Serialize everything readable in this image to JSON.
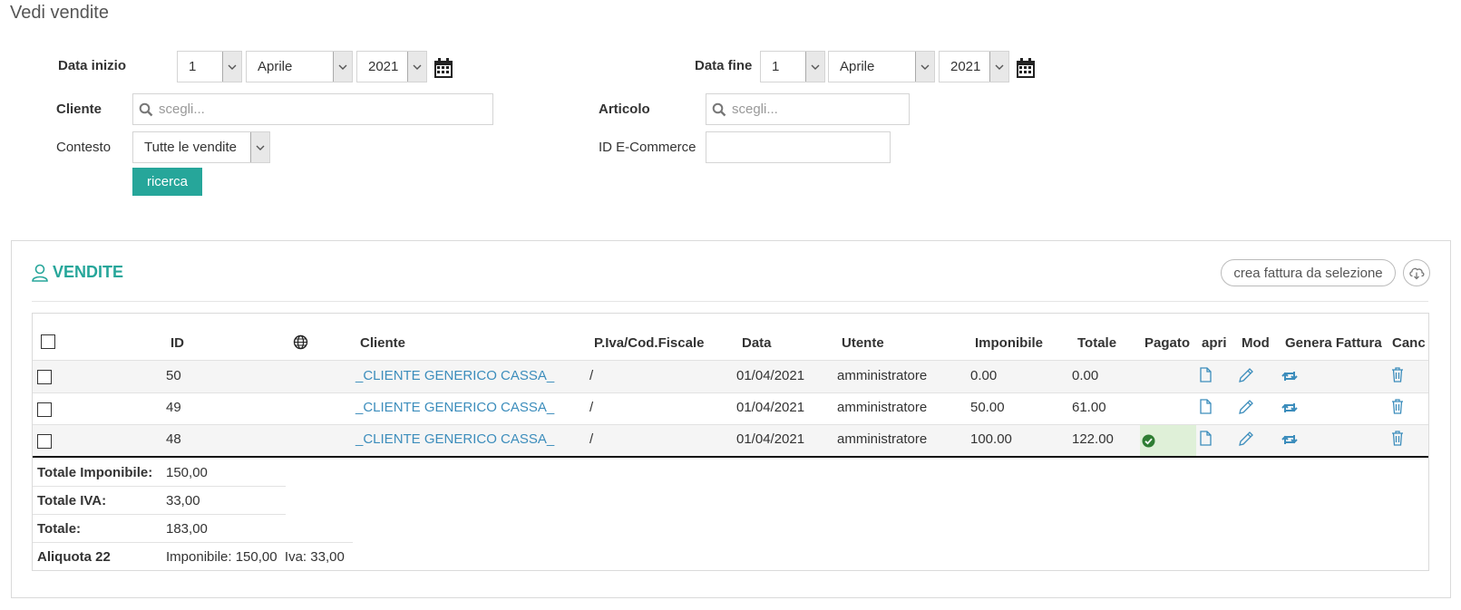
{
  "page": {
    "title": "Vedi vendite"
  },
  "filters": {
    "start_label": "Data inizio",
    "start_day": "1",
    "start_month": "Aprile",
    "start_year": "2021",
    "end_label": "Data fine",
    "end_day": "1",
    "end_month": "Aprile",
    "end_year": "2021",
    "cliente_label": "Cliente",
    "cliente_placeholder": "scegli...",
    "articolo_label": "Articolo",
    "articolo_placeholder": "scegli...",
    "contesto_label": "Contesto",
    "contesto_value": "Tutte le vendite",
    "ecommerce_label": "ID E-Commerce",
    "ecommerce_value": "",
    "search_button": "ricerca"
  },
  "panel": {
    "title": "VENDITE",
    "create_invoice_button": "crea fattura da selezione",
    "icons": {
      "title": "user-icon",
      "download": "cloud-download-icon"
    }
  },
  "table": {
    "headers": {
      "id": "ID",
      "web": "globe-icon",
      "cliente": "Cliente",
      "piva": "P.Iva/Cod.Fiscale",
      "data": "Data",
      "utente": "Utente",
      "imponibile": "Imponibile",
      "totale": "Totale",
      "pagato": "Pagato",
      "apri": "apri",
      "mod": "Mod",
      "genera": "Genera Fattura",
      "canc": "Canc"
    },
    "rows": [
      {
        "id": "50",
        "cliente": "_CLIENTE GENERICO CASSA_",
        "piva": "/",
        "data": "01/04/2021",
        "utente": "amministratore",
        "imponibile": "0.00",
        "totale": "0.00",
        "pagato": false
      },
      {
        "id": "49",
        "cliente": "_CLIENTE GENERICO CASSA_",
        "piva": "/",
        "data": "01/04/2021",
        "utente": "amministratore",
        "imponibile": "50.00",
        "totale": "61.00",
        "pagato": false
      },
      {
        "id": "48",
        "cliente": "_CLIENTE GENERICO CASSA_",
        "piva": "/",
        "data": "01/04/2021",
        "utente": "amministratore",
        "imponibile": "100.00",
        "totale": "122.00",
        "pagato": true
      }
    ],
    "row_icons": {
      "apri": "file-icon",
      "mod": "pencil-icon",
      "genera": "retweet-icon",
      "canc": "trash-icon",
      "pagato": "check-circle-icon"
    }
  },
  "summary": {
    "imponibile_label": "Totale Imponibile:",
    "imponibile_value": "150,00",
    "iva_label": "Totale IVA:",
    "iva_value": "33,00",
    "totale_label": "Totale:",
    "totale_value": "183,00",
    "aliquota_label": "Aliquota 22",
    "aliquota_value": "Imponibile: 150,00  Iva: 33,00"
  },
  "colors": {
    "accent": "#26a69a",
    "link": "#3c8dbc",
    "paid_bg": "#dff0d8",
    "paid_icon": "#2e7d32"
  }
}
